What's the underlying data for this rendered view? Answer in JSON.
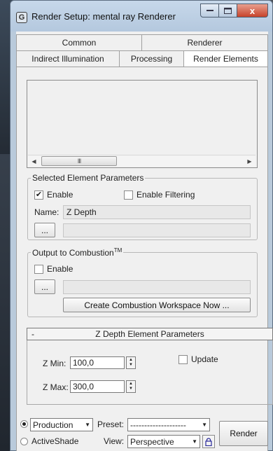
{
  "window": {
    "title": "Render Setup: mental ray Renderer",
    "close_glyph": "x"
  },
  "tabs": {
    "row1": [
      "Common",
      "Renderer"
    ],
    "row2": [
      "Indirect Illumination",
      "Processing",
      "Render Elements"
    ],
    "active": "Render Elements"
  },
  "elements_list": {
    "scroll_thumb": "III"
  },
  "selected_params": {
    "legend": "Selected Element Parameters",
    "enable_label": "Enable",
    "enable_checked": true,
    "filtering_label": "Enable Filtering",
    "filtering_checked": false,
    "name_label": "Name:",
    "name_value": "Z Depth",
    "browse_label": "...",
    "path_value": ""
  },
  "combustion": {
    "legend": "Output to Combustion",
    "legend_tm": "TM",
    "enable_label": "Enable",
    "enable_checked": false,
    "browse_label": "...",
    "path_value": "",
    "create_button": "Create Combustion Workspace Now ..."
  },
  "zdepth_rollout": {
    "toggle": "-",
    "title": "Z Depth Element Parameters",
    "zmin_label": "Z Min:",
    "zmin_value": "100,0",
    "zmax_label": "Z Max:",
    "zmax_value": "300,0",
    "update_label": "Update",
    "update_checked": false
  },
  "bottom": {
    "production_label": "Production",
    "production_selected": true,
    "activeshade_label": "ActiveShade",
    "preset_label": "Preset:",
    "preset_value": "--------------------",
    "view_label": "View:",
    "view_value": "Perspective",
    "render_button": "Render"
  }
}
